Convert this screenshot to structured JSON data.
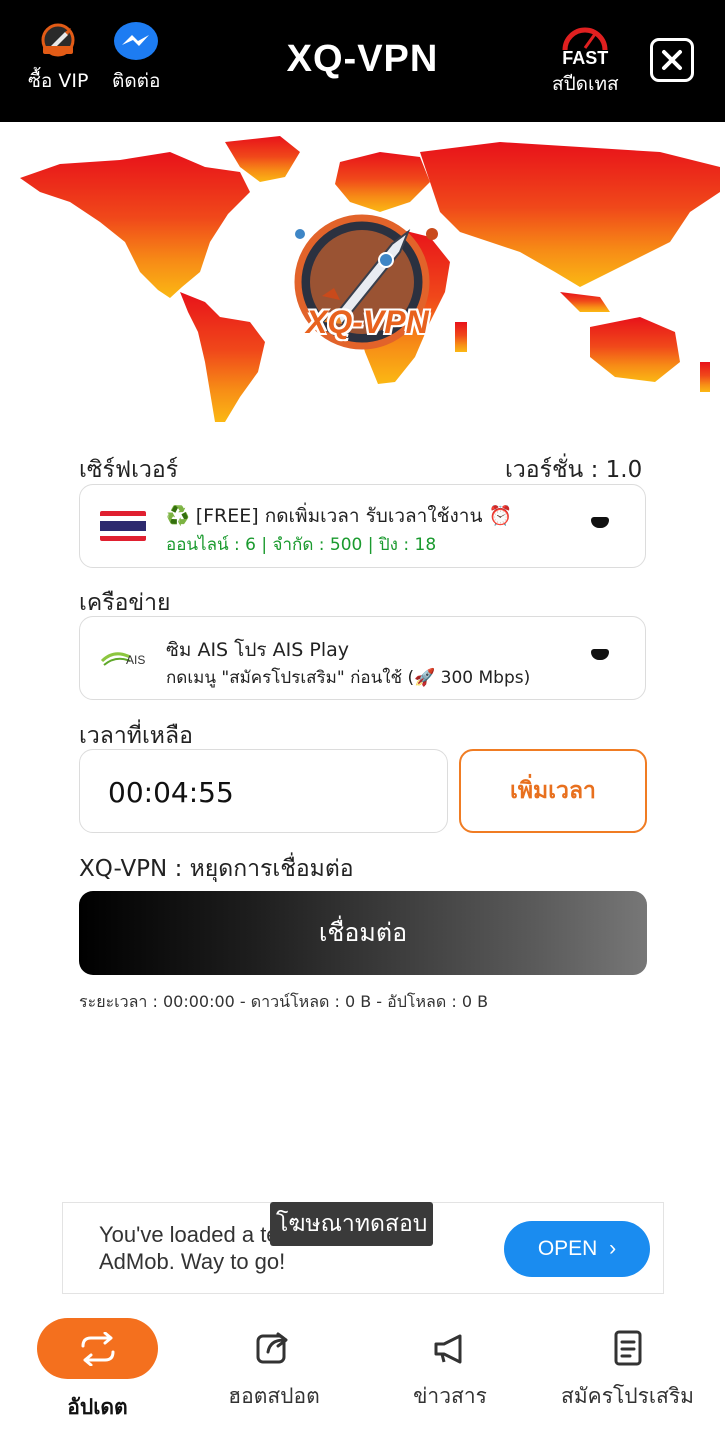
{
  "header": {
    "vip_label": "ซื้อ VIP",
    "contact_label": "ติดต่อ",
    "title": "XQ-VPN",
    "speedtest_badge": "FAST",
    "speedtest_label": "สปีดเทส"
  },
  "logo_text": "XQ-VPN",
  "server": {
    "section_label": "เซิร์ฟเวอร์",
    "version_label": "เวอร์ชั่น : 1.0",
    "name": "♻️ [FREE] กดเพิ่มเวลา รับเวลาใช้งาน ⏰",
    "status": "ออนไลน์ : 6 | จำกัด : 500 | ปิง : 18",
    "status_color": "#1a9a2e"
  },
  "network": {
    "section_label": "เครือข่าย",
    "carrier_logo_text": "AIS",
    "name": "ซิม AIS โปร AIS Play",
    "note": "กดเมนู \"สมัครโปรเสริม\" ก่อนใช้ (🚀 300 Mbps)"
  },
  "timer": {
    "section_label": "เวลาที่เหลือ",
    "value": "00:04:55",
    "add_time_label": "เพิ่มเวลา"
  },
  "connection": {
    "status_text": "XQ-VPN : หยุดการเชื่อมต่อ",
    "connect_label": "เชื่อมต่อ",
    "stats": "ระยะเวลา : 00:00:00 - ดาวน์โหลด : 0 B - อัปโหลด : 0 B"
  },
  "ad": {
    "tag": "โฆษณาทดสอบ",
    "text_line1": "You've loaded a test ad from",
    "text_line2": "AdMob. Way to go!",
    "open_label": "OPEN"
  },
  "bottom_nav": [
    {
      "label": "อัปเดต",
      "icon": "refresh-icon",
      "active": true
    },
    {
      "label": "ฮอตสปอต",
      "icon": "share-icon",
      "active": false
    },
    {
      "label": "ข่าวสาร",
      "icon": "megaphone-icon",
      "active": false
    },
    {
      "label": "สมัครโปรเสริม",
      "icon": "document-icon",
      "active": false
    }
  ],
  "colors": {
    "accent": "#f4701e",
    "header_bg": "#000000",
    "ad_button": "#1a8cf0"
  }
}
